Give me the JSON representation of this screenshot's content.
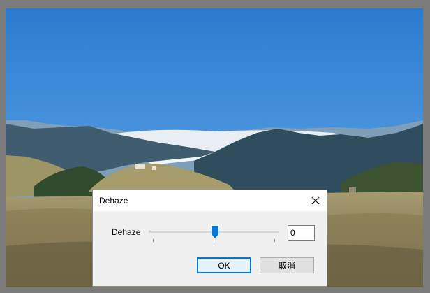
{
  "dialog": {
    "title": "Dehaze",
    "slider_label": "Dehaze",
    "slider_value": 0,
    "slider_fraction": 0.5,
    "ok_label": "OK",
    "cancel_label": "取消"
  },
  "colors": {
    "accent": "#0078d7",
    "workspace_bg": "#7b7b7b"
  }
}
